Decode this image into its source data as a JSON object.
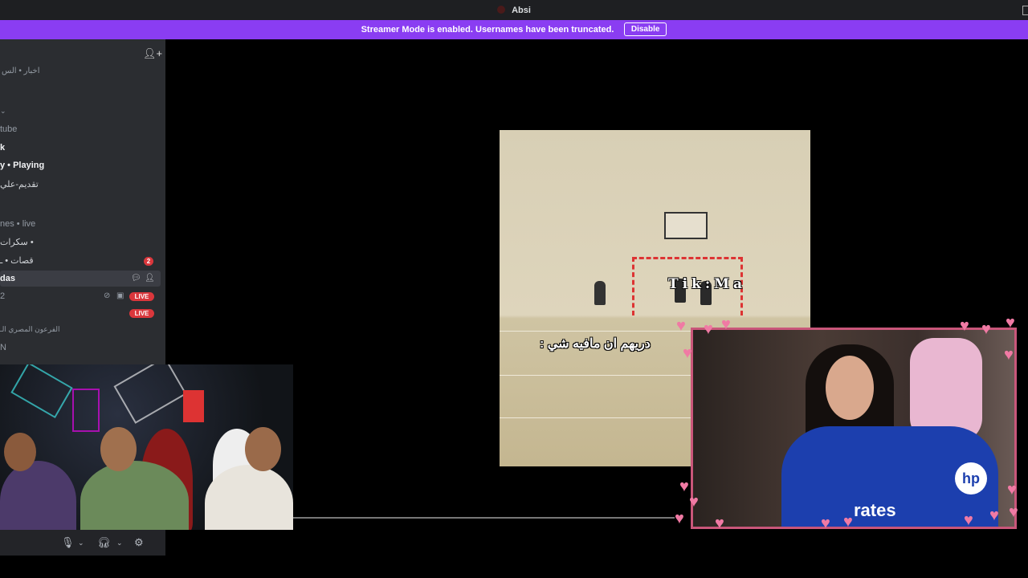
{
  "window": {
    "title": "Absi"
  },
  "banner": {
    "message": "Streamer Mode is enabled. Usernames have been truncated.",
    "disable_label": "Disable"
  },
  "sidebar": {
    "rows": [
      {
        "text": "اخبار • الس"
      },
      {
        "text": "tube"
      },
      {
        "text": "k"
      },
      {
        "text": "y • Playing"
      },
      {
        "text": "تقديم-علي"
      },
      {
        "text": "nes • live"
      },
      {
        "text": "سكرات •"
      },
      {
        "text": "قصات • ـ",
        "badge": "2"
      },
      {
        "text": "das"
      },
      {
        "text": "2",
        "live": "LIVE"
      },
      {
        "live2": "LIVE"
      },
      {
        "text": "الفرعون المصري الـ"
      },
      {
        "text": "N"
      }
    ]
  },
  "video": {
    "watermark": "Tik:Ma",
    "caption": "دريهم ان مافيه شي :"
  },
  "streamer": {
    "jersey_text": "rates",
    "sponsor": "hp"
  },
  "colors": {
    "banner": "#8a3df2",
    "live_badge": "#da373c",
    "cam_border": "#c9567a"
  },
  "icons": [
    "add-friend-icon",
    "chat-icon",
    "mic-icon",
    "headphones-icon",
    "gear-icon",
    "chevron-down-icon",
    "heart-icon"
  ]
}
